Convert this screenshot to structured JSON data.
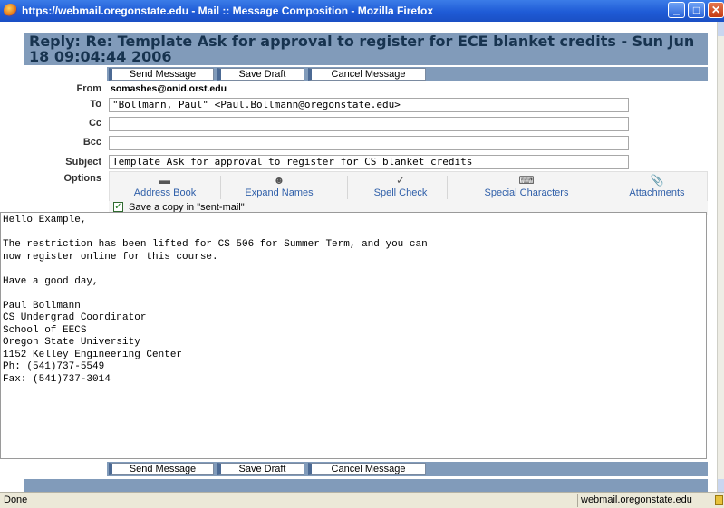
{
  "window": {
    "title": "https://webmail.oregonstate.edu - Mail :: Message Composition - Mozilla Firefox",
    "minimize": "_",
    "maximize": "□",
    "close": "✕"
  },
  "compose": {
    "header_title": "Reply: Re: Template Ask for approval to register for ECE blanket credits - Sun Jun 18 09:04:44 2006",
    "buttons": {
      "send": "Send Message",
      "save_draft": "Save Draft",
      "cancel": "Cancel Message"
    },
    "fields": {
      "from_label": "From",
      "from_value": "somashes@onid.orst.edu",
      "to_label": "To",
      "to_value": "\"Bollmann, Paul\" <Paul.Bollmann@oregonstate.edu>",
      "cc_label": "Cc",
      "cc_value": "",
      "bcc_label": "Bcc",
      "bcc_value": "",
      "subject_label": "Subject",
      "subject_value": "Template Ask for approval to register for CS blanket credits",
      "options_label": "Options"
    },
    "options": [
      {
        "label": "Address Book",
        "icon": "address-book-icon"
      },
      {
        "label": "Expand Names",
        "icon": "expand-names-icon"
      },
      {
        "label": "Spell Check",
        "icon": "spell-check-icon"
      },
      {
        "label": "Special Characters",
        "icon": "special-characters-icon"
      },
      {
        "label": "Attachments",
        "icon": "paperclip-icon"
      }
    ],
    "save_copy_label": "Save a copy in \"sent-mail\"",
    "save_copy_checked": true,
    "body": "Hello Example,\n\nThe restriction has been lifted for CS 506 for Summer Term, and you can\nnow register online for this course.\n\nHave a good day,\n\nPaul Bollmann\nCS Undergrad Coordinator\nSchool of EECS\nOregon State University\n1152 Kelley Engineering Center\nPh: (541)737-5549\nFax: (541)737-3014"
  },
  "status": {
    "left": "Done",
    "right": "webmail.oregonstate.edu"
  },
  "colors": {
    "header_bg": "#819bba",
    "title_bar": "#1f5bd6",
    "link": "#2f5fa9"
  }
}
